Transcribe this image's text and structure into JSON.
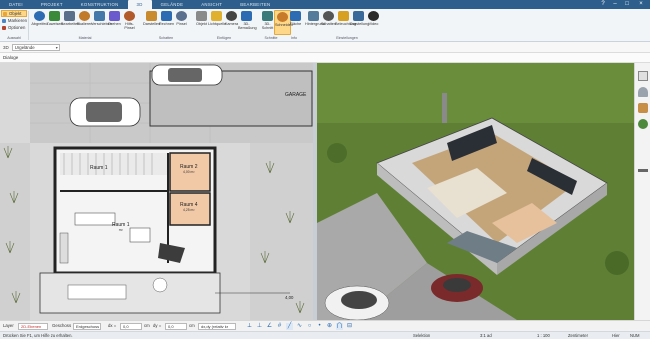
{
  "menu": {
    "tabs": [
      "DATEI",
      "PROJEKT",
      "KONSTRUKTION",
      "3D",
      "GELÄNDE",
      "ANSICHT",
      "BEARBEITEN"
    ],
    "active_index": 3
  },
  "ribbon": {
    "left_items": [
      "Objekt",
      "Markieren",
      "Optionen"
    ],
    "selected_left": 0,
    "buttons": [
      {
        "label": "Abgreifen",
        "icon": "eyedropper-icon"
      },
      {
        "label": "Zuweisen",
        "icon": "assign-icon"
      },
      {
        "label": "Bearbeiten",
        "icon": "edit-material-icon"
      },
      {
        "label": "Skalieren",
        "icon": "scale-icon"
      },
      {
        "label": "Verschieben",
        "icon": "move-texture-icon"
      },
      {
        "label": "Drehen",
        "icon": "rotate-icon"
      },
      {
        "label": "Hilfs-Pinsel",
        "icon": "brush-icon"
      },
      {
        "label": "Darstellen",
        "icon": "shading-icon"
      },
      {
        "label": "Rechnen",
        "icon": "calculate-icon"
      },
      {
        "label": "Pinsel",
        "icon": "pinsel-icon"
      },
      {
        "label": "Objekt",
        "icon": "object-light-icon"
      },
      {
        "label": "Lichtquelle",
        "icon": "light-source-icon"
      },
      {
        "label": "Kamera",
        "icon": "camera-icon"
      },
      {
        "label": "3D-Bemaßung",
        "icon": "dimension-icon"
      },
      {
        "label": "3D-Schnitt",
        "icon": "section-icon"
      },
      {
        "label": "Schneiden",
        "icon": "cut-icon"
      },
      {
        "label": "Fläche",
        "icon": "area-icon"
      },
      {
        "label": "Hintergrund",
        "icon": "background-icon"
      },
      {
        "label": "Schatten",
        "icon": "shadow-icon"
      },
      {
        "label": "Beleuchtung",
        "icon": "lighting-icon"
      },
      {
        "label": "Darstellung",
        "icon": "display-icon"
      },
      {
        "label": "Video",
        "icon": "video-icon"
      }
    ],
    "selected_button": 15,
    "groups": [
      "Auswahl",
      "Material",
      "Schatten",
      "Einfügen",
      "Schnitte",
      "Info",
      "Einstellungen"
    ]
  },
  "subbar": {
    "view_label": "3D",
    "view_value": "Urgelände"
  },
  "doc_tab": "Dialoge",
  "plan": {
    "rooms": [
      {
        "name": "Raum 1",
        "area": "m²"
      },
      {
        "name": "Raum 2",
        "area": "4,00 m²"
      },
      {
        "name": "Raum 3",
        "area": "3,60 m²"
      },
      {
        "name": "Raum 4",
        "area": "4,25 m²"
      }
    ],
    "garage_label": "GARAGE",
    "dimension": "4,00"
  },
  "toolstrip": {
    "layer_label": "Layer",
    "layer_value": "2D-Ebenen",
    "geschoss_label": "Geschoss",
    "geschoss_value": "Erdgeschoss",
    "dx_label": "dx =",
    "dx_value": "0,0",
    "dy_label": "dy =",
    "dy_value": "0,0",
    "unit": "cm",
    "mode": "dx,dy (relativ kr"
  },
  "status": {
    "help": "Drücken Sie F1, um Hilfe zu erhalten.",
    "selection": "Selektion",
    "coords": "3:1 ad",
    "scale": "1 : 100",
    "unit": "Zentimeter",
    "caps": "Hier",
    "num": "NUM"
  },
  "colors": {
    "menu_bg": "#2e5f8c",
    "ribbon_bg": "#f2f5f8",
    "selected": "#ffd788",
    "grass": "#5f8034"
  }
}
